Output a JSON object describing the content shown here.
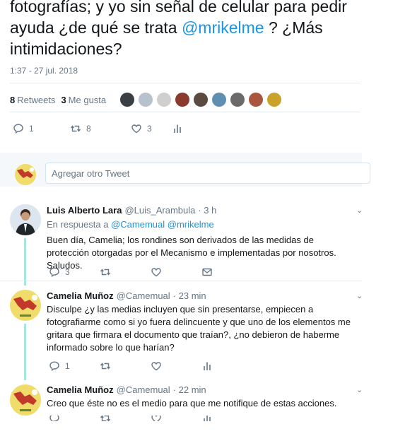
{
  "main_tweet": {
    "text_before": "fotografías; y  yo sin señal de celular para pedir ayuda ¿de qué se trata ",
    "mention": "@mrikelme",
    "text_after": " ? ¿Más intimidaciones?",
    "timestamp": "1:37 - 27 jul. 2018",
    "retweets_count": "8",
    "retweets_label": "Retweets",
    "likes_count": "3",
    "likes_label": "Me gusta",
    "actions": {
      "reply": "1",
      "retweet": "8",
      "like": "3"
    }
  },
  "reply_box": {
    "placeholder": "Agregar otro Tweet"
  },
  "replies": [
    {
      "name": "Luis Alberto Lara",
      "handle": "@Luis_Arambula",
      "time": "· 3 h",
      "reply_to_prefix": "En respuesta a",
      "reply_to_1": "@Camemual",
      "reply_to_2": "@mrikelme",
      "text": "Buen día, Camelia; los rondines son derivados de las medidas de protección otorgadas por el Mecanismo e implementadas por nosotros. Saludos.",
      "reply_count": "3"
    },
    {
      "name": "Camelia Muñoz",
      "handle": "@Camemual",
      "time": "· 23 min",
      "text": "Disculpe ¿y las medias incluyen que sin presentarse, empiecen a fotografiarme como si yo fuera delincuente y que uno de los elementos me gritara que firmara el documento que traían?, ¿no debieron de haberme  informado sobre lo que harían?",
      "reply_count": "1"
    },
    {
      "name": "Camelia Muñoz",
      "handle": "@Camemual",
      "time": "· 22 min",
      "text": "Creo que éste no es el medio para que me notifique de estas acciones."
    }
  ],
  "colors": {
    "link": "#1b95e0",
    "thread": "#a6e6e2",
    "muted": "#657786"
  }
}
